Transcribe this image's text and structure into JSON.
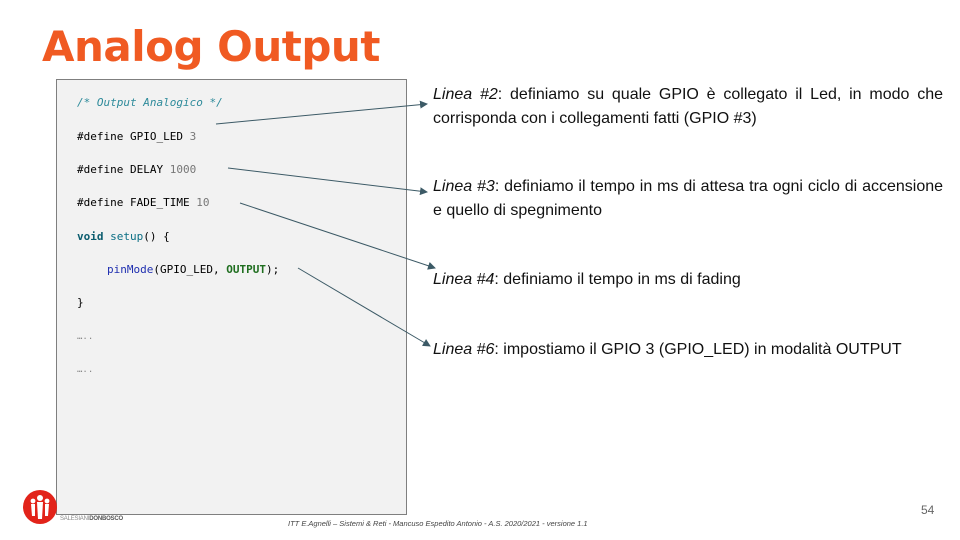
{
  "slide": {
    "title": "Analog Output",
    "page_number": "54",
    "footer": "ITT E.Agnelli – Sistemi & Reti - Mancuso Espedito Antonio - A.S. 2020/2021 - versione 1.1",
    "logo_text_light": "SALESIANI",
    "logo_text_bold": "DONBOSCO"
  },
  "code": {
    "comment": "/* Output Analogico */",
    "l2_kw": "#define GPIO_LED",
    "l2_val": "3",
    "l3_kw": "#define DELAY",
    "l3_val": "1000",
    "l4_kw": "#define FADE_TIME",
    "l4_val": "10",
    "l5_void": "void",
    "l5_fn": "setup",
    "l5_rest": "() {",
    "l6_fn": "pinMode",
    "l6_arg": "(GPIO_LED,",
    "l6_const": "OUTPUT",
    "l6_end": ");",
    "l7": "}",
    "dots1": "…..",
    "dots2": "….."
  },
  "notes": [
    {
      "label": "Linea #2",
      "text": ": definiamo su quale GPIO è collegato il Led, in modo che corrisponda con i collegamenti fatti (GPIO #3)"
    },
    {
      "label": "Linea #3",
      "text": ": definiamo il tempo in ms di attesa tra ogni ciclo di accensione e quello di spegnimento"
    },
    {
      "label": "Linea #4",
      "text": ": definiamo il tempo in ms di fading"
    },
    {
      "label": "Linea #6",
      "text": ": impostiamo il GPIO 3 (GPIO_LED) in modalità OUTPUT"
    }
  ],
  "colors": {
    "title": "#f05a22",
    "code_bg": "#f2f2f2",
    "arrow": "#3c5a66"
  }
}
